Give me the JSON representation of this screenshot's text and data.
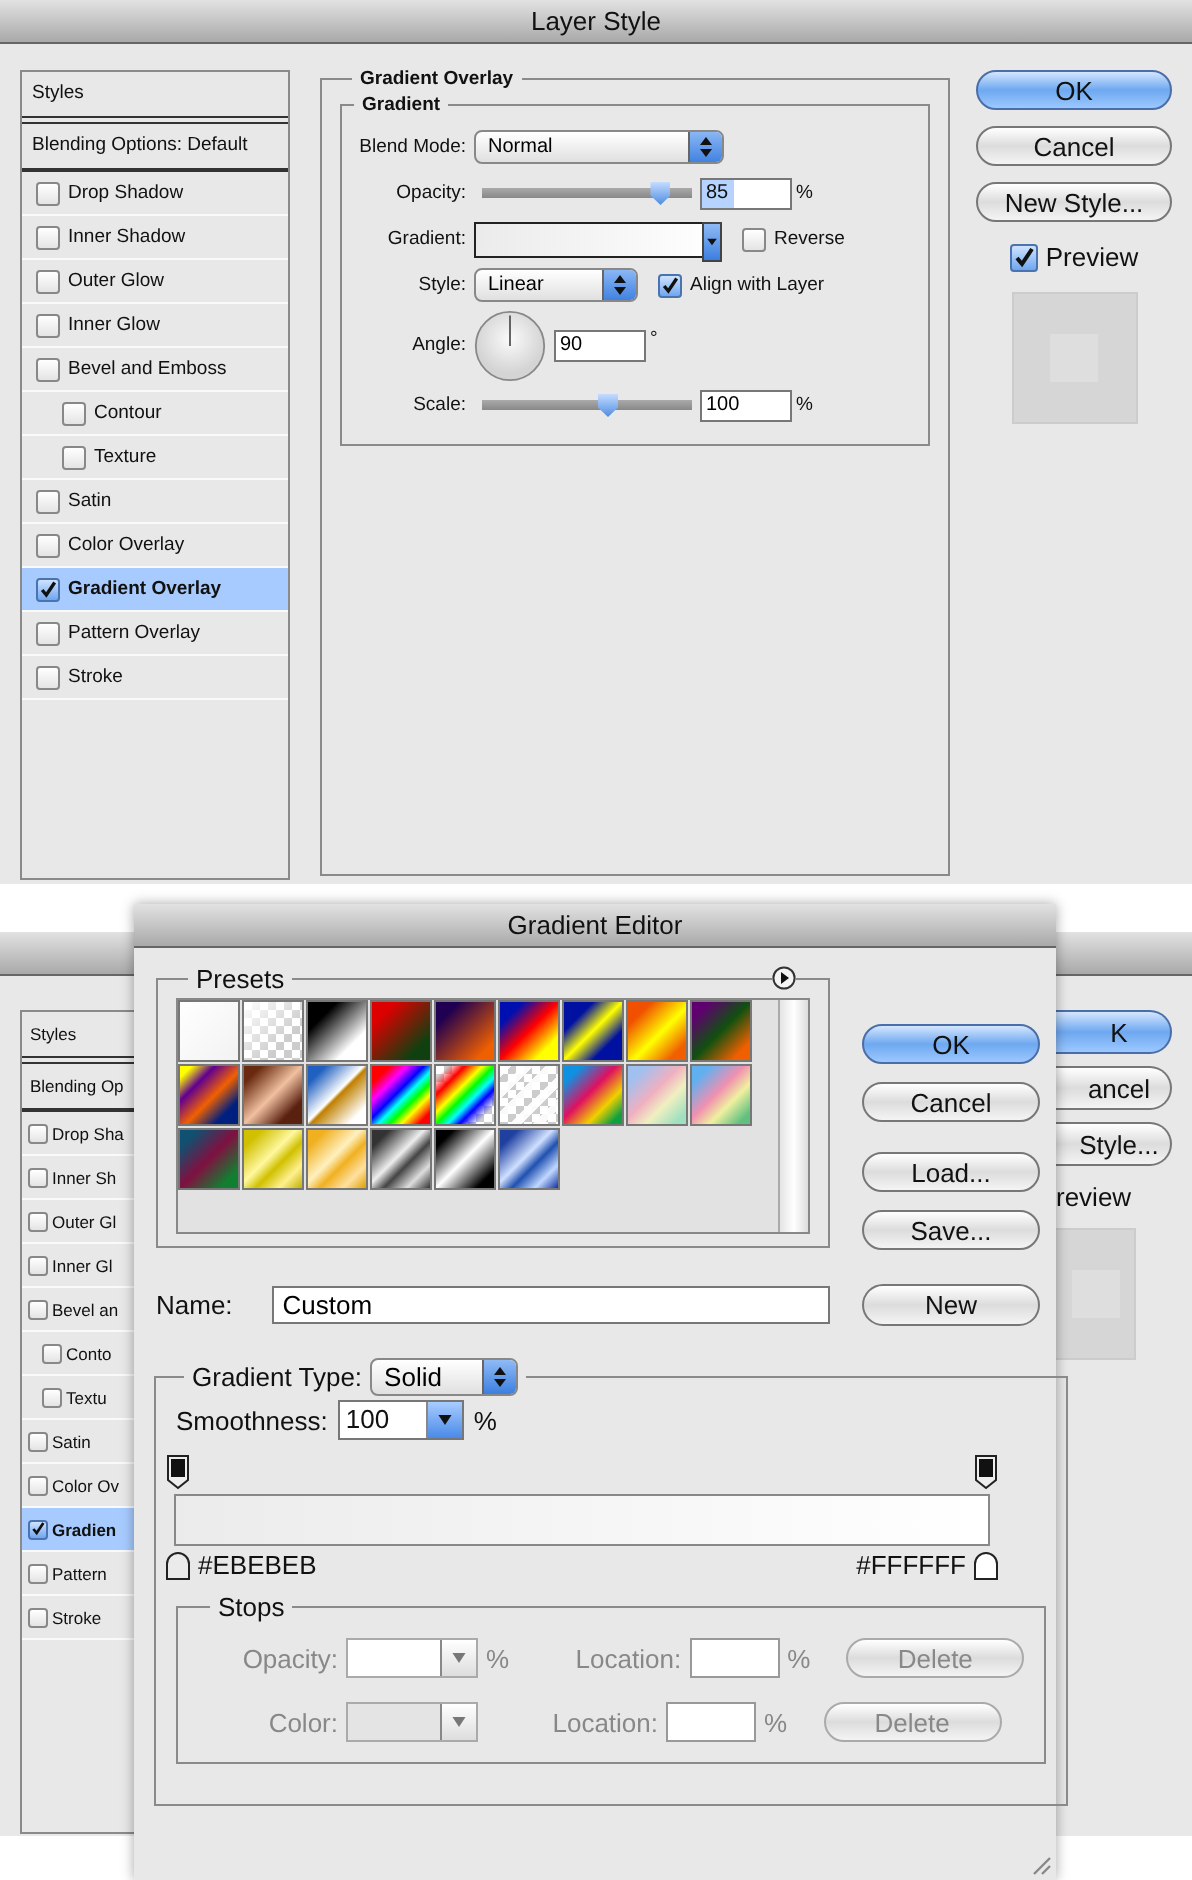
{
  "layer_style": {
    "title": "Layer Style",
    "sidebar": {
      "header": "Styles",
      "blending_options": {
        "label": "Blending Options: Default",
        "selected": false
      },
      "items": [
        {
          "label": "Drop Shadow",
          "checked": false,
          "selected": false
        },
        {
          "label": "Inner Shadow",
          "checked": false,
          "selected": false
        },
        {
          "label": "Outer Glow",
          "checked": false,
          "selected": false
        },
        {
          "label": "Inner Glow",
          "checked": false,
          "selected": false
        },
        {
          "label": "Bevel and Emboss",
          "checked": false,
          "selected": false,
          "children": [
            {
              "label": "Contour",
              "checked": false,
              "selected": false
            },
            {
              "label": "Texture",
              "checked": false,
              "selected": false
            }
          ]
        },
        {
          "label": "Satin",
          "checked": false,
          "selected": false
        },
        {
          "label": "Color Overlay",
          "checked": false,
          "selected": false
        },
        {
          "label": "Gradient Overlay",
          "checked": true,
          "selected": true
        },
        {
          "label": "Pattern Overlay",
          "checked": false,
          "selected": false
        },
        {
          "label": "Stroke",
          "checked": false,
          "selected": false
        }
      ]
    },
    "gradient_overlay": {
      "title": "Gradient Overlay",
      "group_title": "Gradient",
      "blend_mode": {
        "label": "Blend Mode:",
        "value": "Normal"
      },
      "opacity": {
        "label": "Opacity:",
        "level": 0.85,
        "value": "85",
        "unit": "%"
      },
      "gradient": {
        "label": "Gradient:",
        "reverse": {
          "label": "Reverse",
          "checked": false
        }
      },
      "style": {
        "label": "Style:",
        "value": "Linear",
        "align_with_layer": {
          "label": "Align with Layer",
          "checked": true
        }
      },
      "angle": {
        "label": "Angle:",
        "value": "90",
        "unit": "°"
      },
      "scale": {
        "label": "Scale:",
        "level": 0.6,
        "value": "100",
        "unit": "%"
      }
    },
    "buttons": [
      {
        "label": "OK",
        "default": true
      },
      {
        "label": "Cancel",
        "default": false
      },
      {
        "label": "New Style...",
        "default": false
      }
    ],
    "preview": {
      "label": "Preview",
      "checked": true
    }
  },
  "background_layer_style": {
    "sidebar": {
      "header": "Styles",
      "blending_options": {
        "label": "Blending Op",
        "selected": false
      },
      "items": [
        {
          "label": "Drop Sha",
          "checked": false,
          "selected": false
        },
        {
          "label": "Inner Sh",
          "checked": false,
          "selected": false
        },
        {
          "label": "Outer Gl",
          "checked": false,
          "selected": false
        },
        {
          "label": "Inner Gl",
          "checked": false,
          "selected": false
        },
        {
          "label": "Bevel an",
          "checked": false,
          "selected": false,
          "children": [
            {
              "label": "Conto",
              "checked": false,
              "selected": false
            },
            {
              "label": "Textu",
              "checked": false,
              "selected": false
            }
          ]
        },
        {
          "label": "Satin",
          "checked": false,
          "selected": false
        },
        {
          "label": "Color Ov",
          "checked": false,
          "selected": false
        },
        {
          "label": "Gradien",
          "checked": true,
          "selected": true
        },
        {
          "label": "Pattern",
          "checked": false,
          "selected": false
        },
        {
          "label": "Stroke",
          "checked": false,
          "selected": false
        }
      ]
    },
    "buttons": [
      {
        "label": "K",
        "default": true
      },
      {
        "label": "ancel",
        "default": false
      },
      {
        "label": "Style...",
        "default": false
      }
    ],
    "preview_label": "review"
  },
  "gradient_editor": {
    "title": "Gradient Editor",
    "presets_title": "Presets",
    "buttons": [
      {
        "label": "OK",
        "default": true
      },
      {
        "label": "Cancel",
        "default": false
      },
      {
        "label": "Load...",
        "default": false
      },
      {
        "label": "Save...",
        "default": false
      }
    ],
    "name": {
      "label": "Name:",
      "value": "Custom"
    },
    "new_button": "New",
    "gradient_type": {
      "label": "Gradient Type:",
      "value": "Solid"
    },
    "smoothness": {
      "label": "Smoothness:",
      "value": "100",
      "unit": "%"
    },
    "color_stops": [
      {
        "label": "#EBEBEB",
        "color": "#ebebeb"
      },
      {
        "label": "#FFFFFF",
        "color": "#ffffff"
      }
    ],
    "stops": {
      "title": "Stops",
      "rows": [
        {
          "kind": "opacity",
          "label": "Opacity:",
          "unit": "%",
          "location_label": "Location:",
          "location_unit": "%",
          "delete": "Delete",
          "disabled": true
        },
        {
          "kind": "color",
          "label": "Color:",
          "location_label": "Location:",
          "location_unit": "%",
          "delete": "Delete",
          "disabled": true
        }
      ]
    }
  }
}
